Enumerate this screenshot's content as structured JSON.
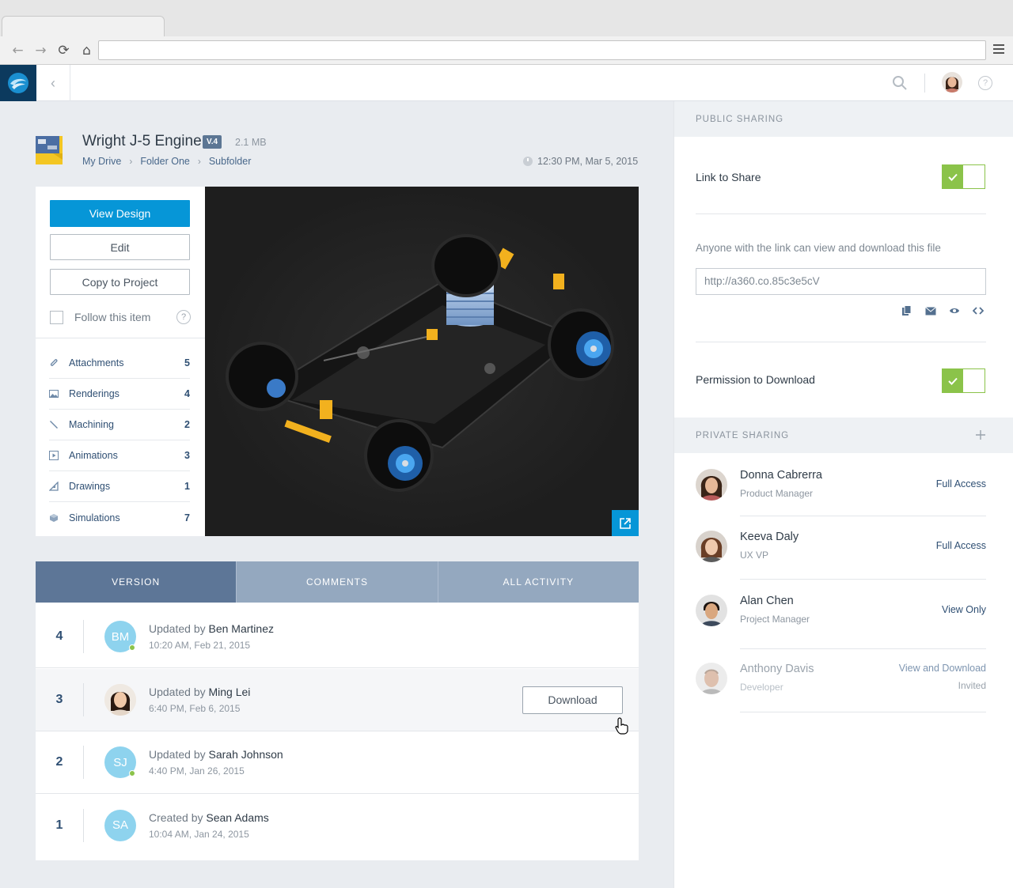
{
  "browser": {
    "nav": {
      "back": "←",
      "forward": "→",
      "reload": "⟳",
      "home": "⌂"
    },
    "url": ""
  },
  "header": {
    "back_label": "‹",
    "help_label": "?"
  },
  "file": {
    "title": "Wright J-5 Engine",
    "version": "V.4",
    "size": "2.1 MB",
    "breadcrumb": [
      "My Drive",
      "Folder One",
      "Subfolder"
    ],
    "breadcrumb_sep": "›",
    "timestamp": "12:30 PM, Mar 5, 2015"
  },
  "actions": {
    "view_design": "View Design",
    "edit": "Edit",
    "copy_to_project": "Copy to Project",
    "follow": "Follow this item",
    "help": "?"
  },
  "attachments": [
    {
      "icon": "paperclip-icon",
      "label": "Attachments",
      "count": "5"
    },
    {
      "icon": "image-icon",
      "label": "Renderings",
      "count": "4"
    },
    {
      "icon": "wrench-icon",
      "label": "Machining",
      "count": "2"
    },
    {
      "icon": "play-icon",
      "label": "Animations",
      "count": "3"
    },
    {
      "icon": "triangle-ruler-icon",
      "label": "Drawings",
      "count": "1"
    },
    {
      "icon": "cube-icon",
      "label": "Simulations",
      "count": "7"
    }
  ],
  "tabs": [
    {
      "label": "VERSION",
      "active": true
    },
    {
      "label": "COMMENTS",
      "active": false
    },
    {
      "label": "ALL ACTIVITY",
      "active": false
    }
  ],
  "versions": [
    {
      "num": "4",
      "initials": "BM",
      "verb": "Updated by",
      "name": "Ben Martinez",
      "date": "10:20 AM, Feb 21, 2015",
      "online": true
    },
    {
      "num": "3",
      "initials": "",
      "verb": "Updated by",
      "name": "Ming Lei",
      "date": "6:40 PM, Feb 6, 2015",
      "download": "Download"
    },
    {
      "num": "2",
      "initials": "SJ",
      "verb": "Updated by",
      "name": "Sarah Johnson",
      "date": "4:40 PM, Jan 26, 2015",
      "online": true
    },
    {
      "num": "1",
      "initials": "SA",
      "verb": "Created by",
      "name": "Sean Adams",
      "date": "10:04 AM, Jan 24, 2015"
    }
  ],
  "public_sharing": {
    "header": "PUBLIC SHARING",
    "link_label": "Link to Share",
    "link_enabled": true,
    "description": "Anyone with the link can view and download this file",
    "url": "http://a360.co.85c3e5cV",
    "share_icons": [
      "copy-icon",
      "email-icon",
      "eye-icon",
      "embed-icon"
    ],
    "permission_label": "Permission to Download",
    "permission_enabled": true
  },
  "private_sharing": {
    "header": "PRIVATE SHARING",
    "add": "+",
    "people": [
      {
        "name": "Donna Cabrerra",
        "role": "Product Manager",
        "access": "Full Access"
      },
      {
        "name": "Keeva Daly",
        "role": "UX VP",
        "access": "Full Access"
      },
      {
        "name": "Alan Chen",
        "role": "Project Manager",
        "access": "View Only"
      },
      {
        "name": "Anthony Davis",
        "role": "Developer",
        "access": "View and Download",
        "status": "Invited"
      }
    ]
  },
  "colors": {
    "primary": "#0696d7",
    "tab_active": "#5d7697",
    "tab_inactive": "#94a8bf",
    "toggle_on": "#8bc34a",
    "avatar_bg": "#8ed3ee"
  }
}
